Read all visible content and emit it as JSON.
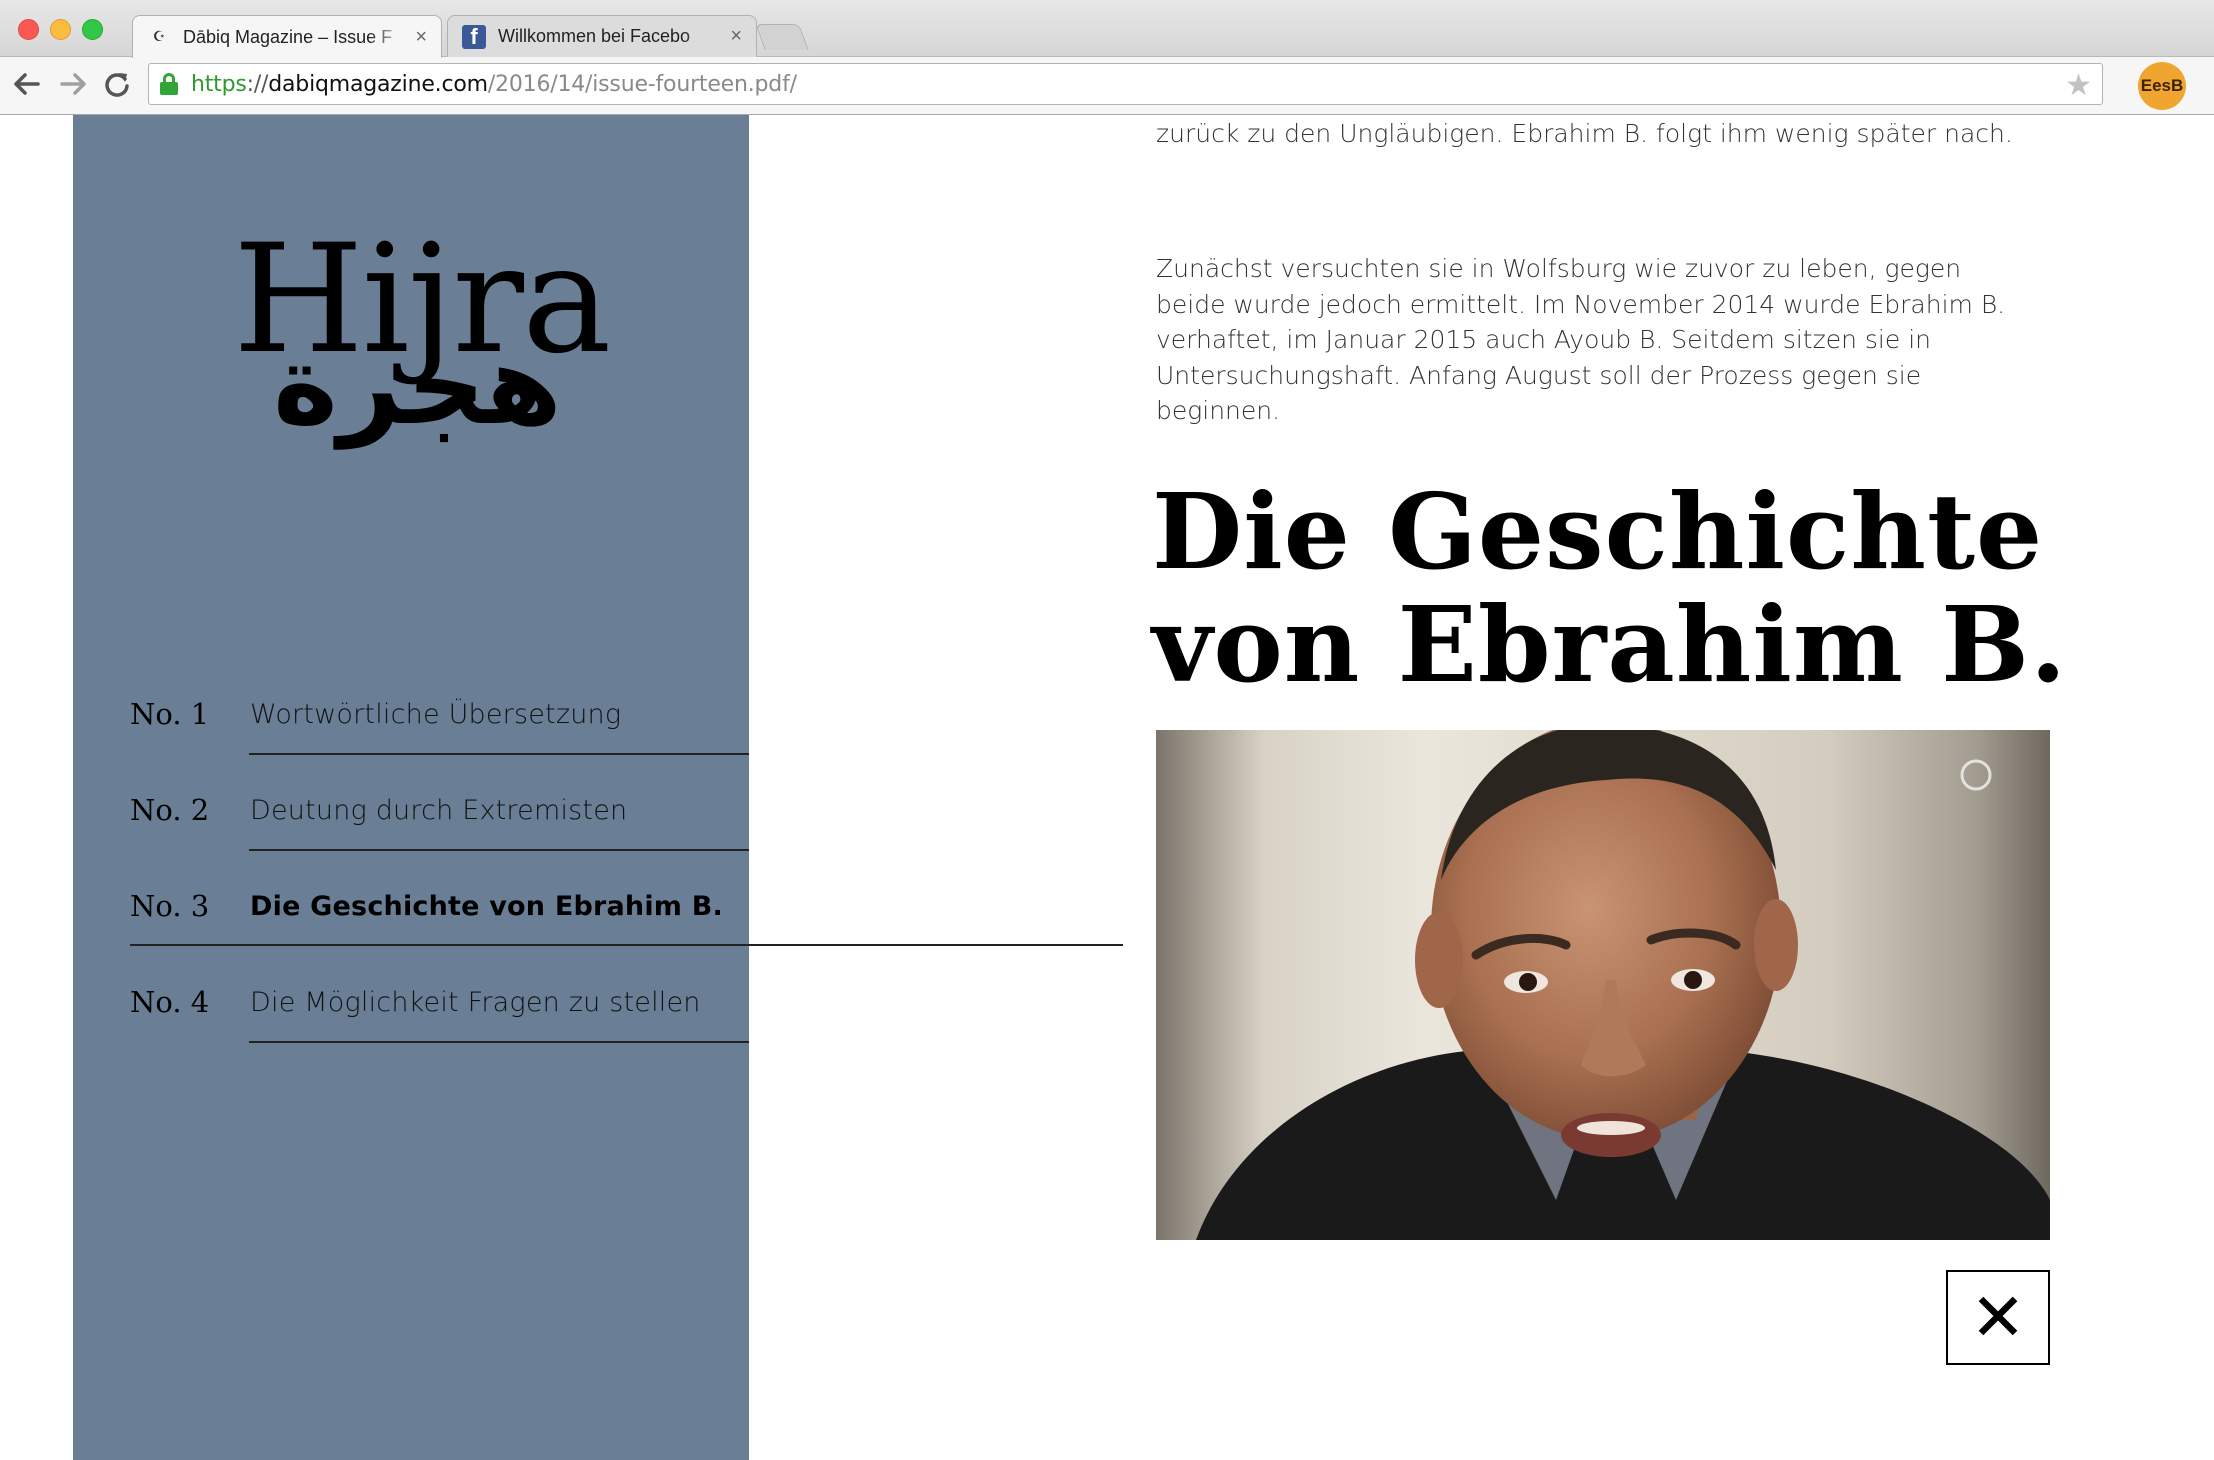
{
  "browser": {
    "tabs": [
      {
        "title": "Dābiq Magazine – Issue F",
        "favicon": "dabiq-favicon",
        "active": true
      },
      {
        "title": "Willkommen bei Facebo",
        "favicon": "facebook-favicon",
        "active": false
      }
    ],
    "tab_close_glyph": "×",
    "url": {
      "scheme": "https",
      "separator": "://",
      "host": "dabiqmagazine.com",
      "path": "/2016/14/issue-fourteen.pdf/"
    },
    "profile_label": "EesB",
    "nav_icons": [
      "back-arrow-icon",
      "forward-arrow-icon",
      "reload-icon"
    ],
    "accent_secure": "#31a636"
  },
  "sidebar": {
    "logo_latin": "Hijra",
    "logo_arabic": "هجرة",
    "background": "#6a7f95",
    "toc": [
      {
        "number": "No. 1",
        "label": "Wortwörtliche Übersetzung",
        "active": false
      },
      {
        "number": "No. 2",
        "label": "Deutung durch Extremisten",
        "active": false
      },
      {
        "number": "No. 3",
        "label": "Die Geschichte von Ebrahim B.",
        "active": true
      },
      {
        "number": "No. 4",
        "label": "Die Möglichkeit Fragen zu stellen",
        "active": false
      }
    ]
  },
  "article": {
    "paragraph_cut": "seinen hinterhältigen Rücken und ging zurück zur Dschāhilīyān\" – zurück zu den Ungläubigen. Ebrahim B. folgt ihm wenig später nach.",
    "paragraph": "Zunächst versuchten sie in Wolfsburg wie zuvor zu leben, gegen beide wurde jedoch ermittelt. Im November 2014 wurde Ebrahim B. verhaftet, im Januar 2015 auch Ayoub B. Seitdem sitzen sie in Untersuchungshaft. Anfang August soll der Prozess gegen sie beginnen.",
    "headline_line1": "Die Geschichte",
    "headline_line2": "von Ebrahim B.",
    "photo_alt": "Portrait photo of Ebrahim B.",
    "close_glyph": "✕"
  }
}
